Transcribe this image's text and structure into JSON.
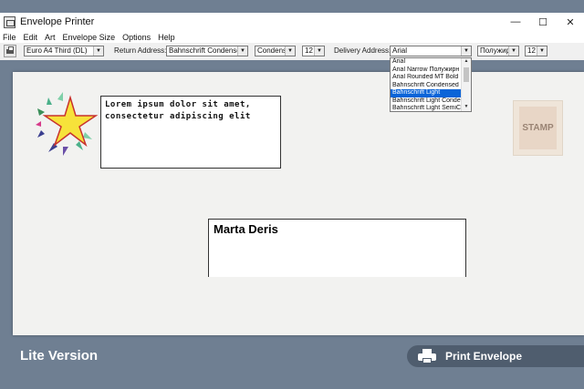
{
  "window": {
    "title": "Envelope Printer",
    "controls": [
      "—",
      "☐",
      "✕"
    ]
  },
  "menu": [
    "File",
    "Edit",
    "Art",
    "Envelope Size",
    "Options",
    "Help"
  ],
  "toolbar": {
    "envelope_size": "Euro A4 Third (DL)",
    "return_label": "Return Address:",
    "return_font": "Bahnschrift Condensed",
    "return_style": "Condense",
    "return_size": "12",
    "delivery_label": "Delivery Address:",
    "delivery_font": "Arial",
    "delivery_style": "Полужир",
    "delivery_size": "12"
  },
  "font_dropdown": {
    "items": [
      "Arial",
      "Arial Narrow Полужирн",
      "Arial Rounded MT Bold",
      "Bahnschrift Condensed",
      "Bahnschrift Light",
      "Bahnschrift Light Conden",
      "Bahnschrift Light SemiCo"
    ],
    "selected_index": 4
  },
  "envelope": {
    "return_address": [
      "Lorem ipsum dolor sit amet,",
      "consectetur adipiscing elit"
    ],
    "stamp_label": "STAMP",
    "delivery_name": "Marta Deris"
  },
  "footer": {
    "version": "Lite Version",
    "print_label": "Print Envelope"
  },
  "colors": {
    "background": "#6f7f92",
    "selection": "#0a64d8",
    "print_button": "#4f5d6e"
  }
}
